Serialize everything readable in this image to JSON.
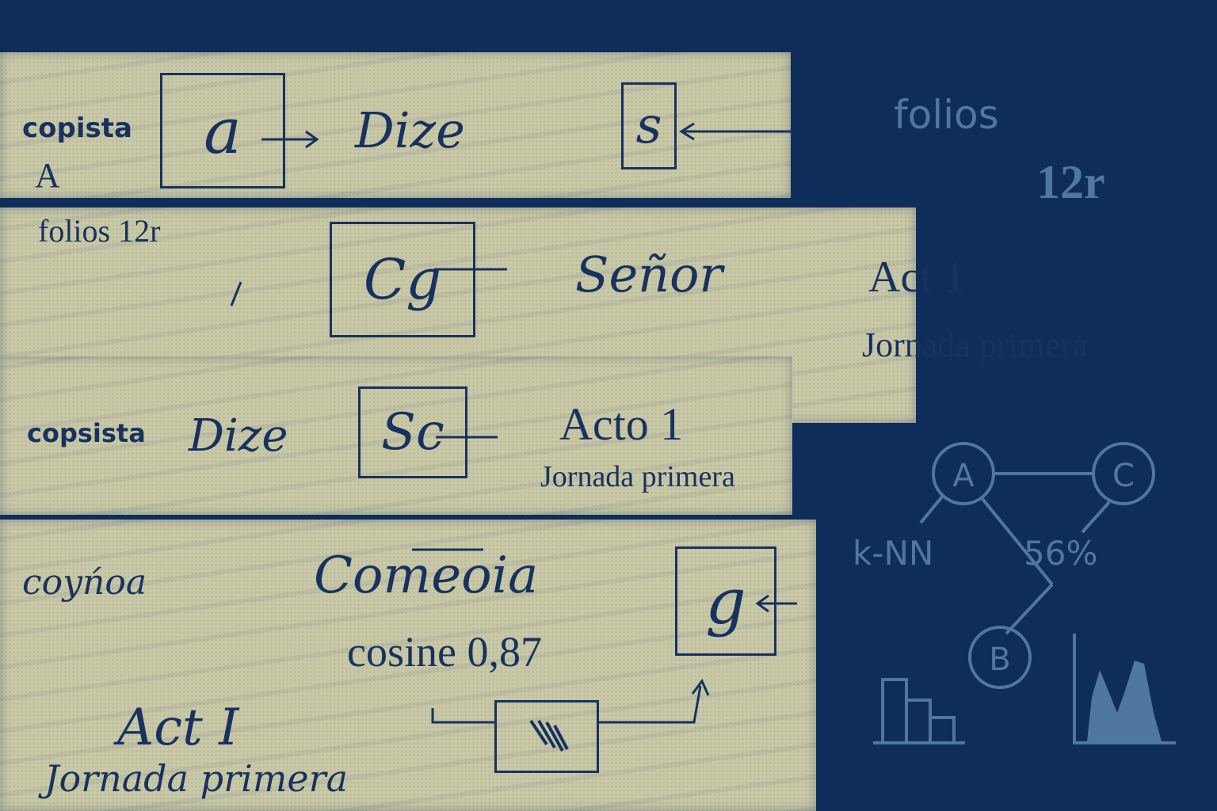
{
  "strip1": {
    "label_copista": "copista",
    "label_a": "A",
    "label_folios": "folios 12r",
    "glyph_box": "a",
    "word": "Dize",
    "glyph_box_right": "s"
  },
  "strip2": {
    "glyph_box": "Cg",
    "word": "Señor",
    "act": "Act 1",
    "jornada": "Jornada primera"
  },
  "strip3": {
    "label_copista": "copsista",
    "word": "Dize",
    "glyph_box": "Sc",
    "act": "Acto 1",
    "jornada": "Jornada primera"
  },
  "strip4": {
    "label_copista": "coyńoa",
    "word": "Comeoia",
    "glyph_box": "g",
    "cosine": "cosine 0,87",
    "act": "Act I",
    "jornada": "Jornada primera"
  },
  "right_panel": {
    "folios": "folios",
    "folio_number": "12r",
    "knn_label": "k-NN",
    "percent": "56%",
    "node_a": "A",
    "node_b": "B",
    "node_c": "C"
  },
  "colors": {
    "background": "#0f2d5a",
    "parchment": "#c9c8a6",
    "ink": "#17325f",
    "pale": "#4f77a0"
  }
}
